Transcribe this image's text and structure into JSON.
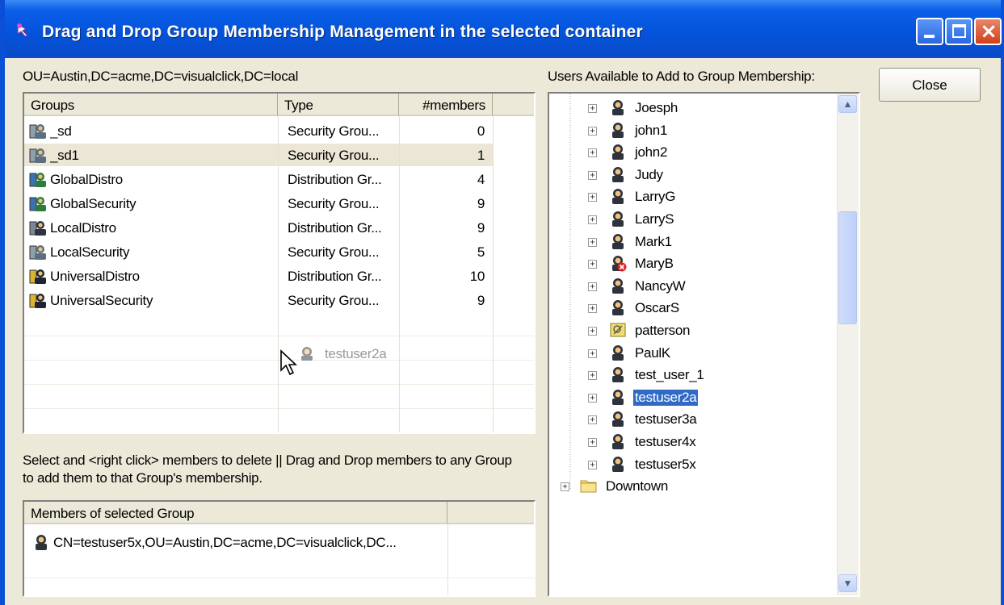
{
  "window": {
    "title": "Drag and Drop Group Membership Management in the selected container"
  },
  "container_path": "OU=Austin,DC=acme,DC=visualclick,DC=local",
  "users_label": "Users Available to Add to Group Membership:",
  "close_label": "Close",
  "groups_table": {
    "columns": [
      "Groups",
      "Type",
      "#members"
    ],
    "rows": [
      {
        "name": "_sd",
        "type": "Security Grou...",
        "members": "0",
        "icon": "domain-local-security-group-icon"
      },
      {
        "name": "_sd1",
        "type": "Security Grou...",
        "members": "1",
        "icon": "domain-local-security-group-icon",
        "selected": true
      },
      {
        "name": "GlobalDistro",
        "type": "Distribution Gr...",
        "members": "4",
        "icon": "global-distribution-group-icon"
      },
      {
        "name": "GlobalSecurity",
        "type": "Security Grou...",
        "members": "9",
        "icon": "global-security-group-icon"
      },
      {
        "name": "LocalDistro",
        "type": "Distribution Gr...",
        "members": "9",
        "icon": "domain-local-distribution-group-icon"
      },
      {
        "name": "LocalSecurity",
        "type": "Security Grou...",
        "members": "5",
        "icon": "domain-local-security-group-icon"
      },
      {
        "name": "UniversalDistro",
        "type": "Distribution Gr...",
        "members": "10",
        "icon": "universal-distribution-group-icon"
      },
      {
        "name": "UniversalSecurity",
        "type": "Security Grou...",
        "members": "9",
        "icon": "universal-security-group-icon"
      }
    ]
  },
  "drag_ghost": {
    "label": "testuser2a",
    "icon": "user-icon"
  },
  "instructions": "Select and <right click> members to delete || Drag and Drop members to any Group to add them to that Group's membership.",
  "members_table": {
    "columns": [
      "Members of selected Group",
      ""
    ],
    "rows": [
      {
        "value": "CN=testuser5x,OU=Austin,DC=acme,DC=visualclick,DC...",
        "icon": "user-icon"
      }
    ]
  },
  "user_tree": {
    "items": [
      {
        "label": "Joesph",
        "icon": "user-icon"
      },
      {
        "label": "john1",
        "icon": "user-icon"
      },
      {
        "label": "john2",
        "icon": "user-icon"
      },
      {
        "label": "Judy",
        "icon": "user-icon"
      },
      {
        "label": "LarryG",
        "icon": "user-icon"
      },
      {
        "label": "LarryS",
        "icon": "user-icon"
      },
      {
        "label": "Mark1",
        "icon": "user-icon"
      },
      {
        "label": "MaryB",
        "icon": "disabled-user-icon"
      },
      {
        "label": "NancyW",
        "icon": "user-icon"
      },
      {
        "label": "OscarS",
        "icon": "user-icon"
      },
      {
        "label": "patterson",
        "icon": "contact-icon"
      },
      {
        "label": "PaulK",
        "icon": "user-icon"
      },
      {
        "label": "test_user_1",
        "icon": "user-icon"
      },
      {
        "label": "testuser2a",
        "icon": "user-icon",
        "selected": true
      },
      {
        "label": "testuser3a",
        "icon": "user-icon"
      },
      {
        "label": "testuser4x",
        "icon": "user-icon"
      },
      {
        "label": "testuser5x",
        "icon": "user-icon"
      }
    ],
    "folder": {
      "label": "Downtown",
      "icon": "folder-icon"
    }
  },
  "colors": {
    "title_bar": "#0a5ee8",
    "selection": "#316ac5",
    "window_face": "#ece9d8"
  }
}
